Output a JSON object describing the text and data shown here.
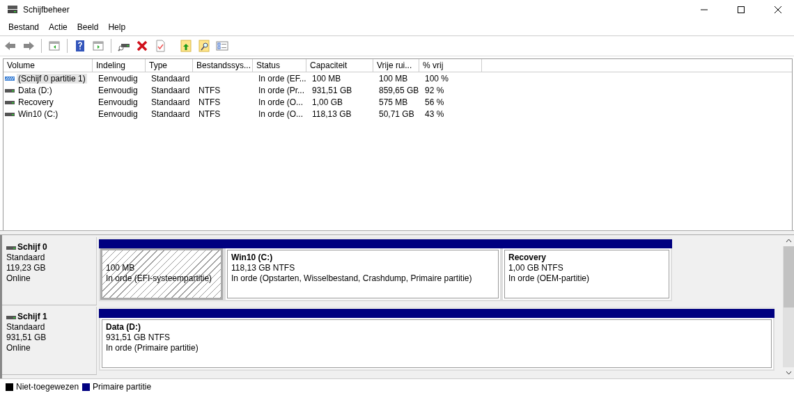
{
  "window": {
    "title": "Schijfbeheer"
  },
  "menu": [
    "Bestand",
    "Actie",
    "Beeld",
    "Help"
  ],
  "table": {
    "columns": [
      "Volume",
      "Indeling",
      "Type",
      "Bestandssys...",
      "Status",
      "Capaciteit",
      "Vrije rui...",
      "% vrij"
    ],
    "rows": [
      {
        "selected": true,
        "kind": "efi",
        "cells": [
          "(Schijf 0 partitie 1)",
          "Eenvoudig",
          "Standaard",
          "",
          "In orde (EF...",
          "100 MB",
          "100 MB",
          "100 %"
        ]
      },
      {
        "selected": false,
        "kind": "disk",
        "cells": [
          "Data (D:)",
          "Eenvoudig",
          "Standaard",
          "NTFS",
          "In orde (Pr...",
          "931,51 GB",
          "859,65 GB",
          "92 %"
        ]
      },
      {
        "selected": false,
        "kind": "disk",
        "cells": [
          "Recovery",
          "Eenvoudig",
          "Standaard",
          "NTFS",
          "In orde (O...",
          "1,00 GB",
          "575 MB",
          "56 %"
        ]
      },
      {
        "selected": false,
        "kind": "disk",
        "cells": [
          "Win10 (C:)",
          "Eenvoudig",
          "Standaard",
          "NTFS",
          "In orde (O...",
          "118,13 GB",
          "50,71 GB",
          "43 %"
        ]
      }
    ]
  },
  "disks": [
    {
      "name": "Schijf 0",
      "type": "Standaard",
      "size": "119,23 GB",
      "state": "Online",
      "partitions": [
        {
          "selected": true,
          "size": "100 MB",
          "status": "In orde (EFI-systeempartitie)"
        },
        {
          "selected": false,
          "name": "Win10  (C:)",
          "size": "118,13 GB NTFS",
          "status": "In orde (Opstarten, Wisselbestand, Crashdump, Primaire partitie)"
        },
        {
          "selected": false,
          "name": "Recovery",
          "size": "1,00 GB NTFS",
          "status": "In orde (OEM-partitie)"
        }
      ]
    },
    {
      "name": "Schijf 1",
      "type": "Standaard",
      "size": "931,51 GB",
      "state": "Online",
      "partitions": [
        {
          "selected": false,
          "name": "Data  (D:)",
          "size": "931,51 GB NTFS",
          "status": "In orde (Primaire partitie)"
        }
      ]
    }
  ],
  "legend": [
    {
      "label": "Niet-toegewezen",
      "color": "#000000"
    },
    {
      "label": "Primaire partitie",
      "color": "#000080"
    }
  ]
}
